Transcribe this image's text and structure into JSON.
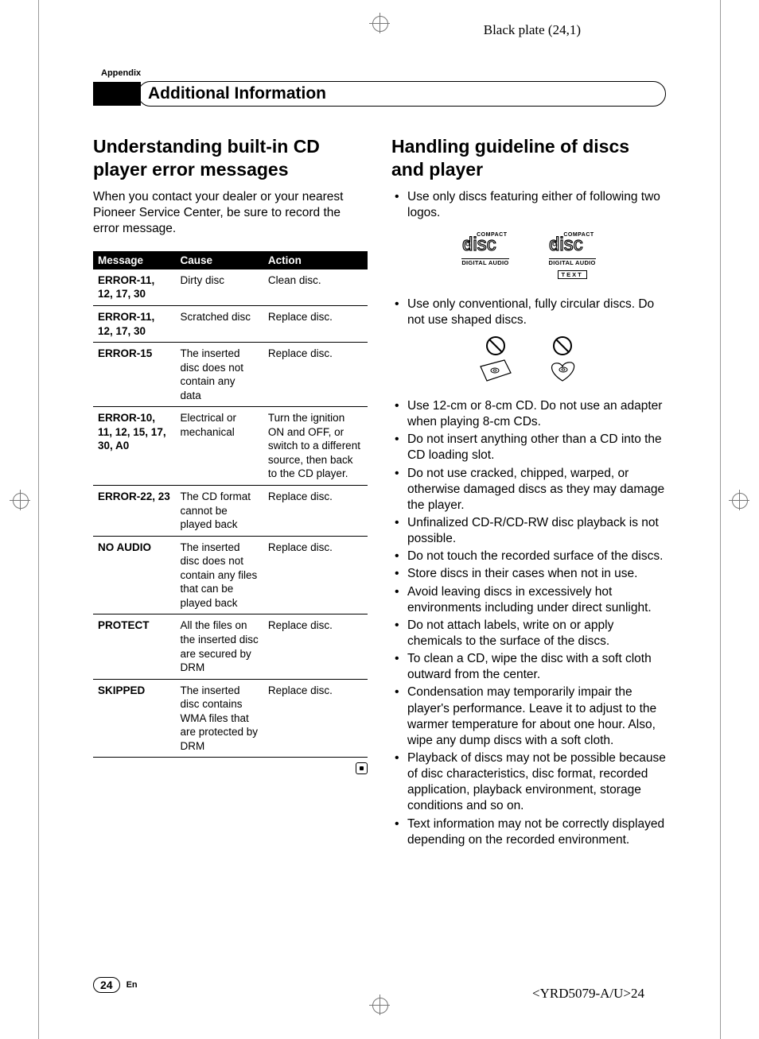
{
  "plate_info": "Black plate (24,1)",
  "appendix": "Appendix",
  "header_title": "Additional Information",
  "left": {
    "heading": "Understanding built-in CD player error messages",
    "intro": "When you contact your dealer or your nearest Pioneer Service Center, be sure to record the error message.",
    "table": {
      "headers": [
        "Message",
        "Cause",
        "Action"
      ],
      "rows": [
        {
          "msg": "ERROR-11, 12, 17, 30",
          "cause": "Dirty disc",
          "action": "Clean disc."
        },
        {
          "msg": "ERROR-11, 12, 17, 30",
          "cause": "Scratched disc",
          "action": "Replace disc."
        },
        {
          "msg": "ERROR-15",
          "cause": "The inserted disc does not contain any data",
          "action": "Replace disc."
        },
        {
          "msg": "ERROR-10, 11, 12, 15, 17, 30, A0",
          "cause": "Electrical or mechanical",
          "action": "Turn the ignition ON and OFF, or switch to a different source, then back to the CD player."
        },
        {
          "msg": "ERROR-22, 23",
          "cause": "The CD format cannot be played back",
          "action": "Replace disc."
        },
        {
          "msg": "NO AUDIO",
          "cause": "The inserted disc does not contain any files that can be played back",
          "action": "Replace disc."
        },
        {
          "msg": "PROTECT",
          "cause": "All the files on the inserted disc are secured by DRM",
          "action": "Replace disc."
        },
        {
          "msg": "SKIPPED",
          "cause": "The inserted disc contains WMA files that are protected by DRM",
          "action": "Replace disc."
        }
      ]
    }
  },
  "right": {
    "heading": "Handling guideline of discs and player",
    "bullet_logos": "Use only discs featuring either of following two logos.",
    "logo_compact": "COMPACT",
    "logo_digital": "DIGITAL AUDIO",
    "logo_text": "TEXT",
    "bullet_shaped": "Use only conventional, fully circular discs. Do not use shaped discs.",
    "bullets_rest": [
      "Use 12-cm or 8-cm CD. Do not use an adapter when playing 8-cm CDs.",
      "Do not insert anything other than a CD into the CD loading slot.",
      "Do not use cracked, chipped, warped, or otherwise damaged discs as they may damage the player.",
      "Unfinalized CD-R/CD-RW disc playback is not possible.",
      "Do not touch the recorded surface of the discs.",
      "Store discs in their cases when not in use.",
      "Avoid leaving discs in excessively hot environments including under direct sunlight.",
      "Do not attach labels, write on or apply chemicals to the surface of the discs.",
      "To clean a CD, wipe the disc with a soft cloth outward from the center.",
      "Condensation may temporarily impair the player's performance. Leave it to adjust to the warmer temperature for about one hour. Also, wipe any dump discs with a soft cloth.",
      "Playback of discs may not be possible because of disc characteristics, disc format, recorded application, playback environment, storage conditions and so on.",
      "Text information may not be correctly displayed depending on the recorded environment."
    ]
  },
  "page_number": "24",
  "lang": "En",
  "doc_id": "<YRD5079-A/U>24"
}
